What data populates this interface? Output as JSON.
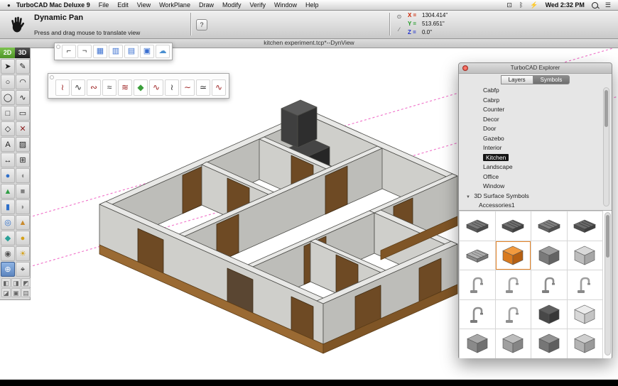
{
  "menu_bar": {
    "apple_glyph": "●",
    "app_name": "TurboCAD Mac Deluxe 9",
    "menus": [
      "File",
      "Edit",
      "View",
      "WorkPlane",
      "Draw",
      "Modify",
      "Verify",
      "Window",
      "Help"
    ],
    "status_icons": [
      {
        "name": "display-icon",
        "glyph": "⊡"
      },
      {
        "name": "bluetooth-icon",
        "glyph": "ᛒ"
      },
      {
        "name": "battery-icon",
        "glyph": "⚡"
      }
    ],
    "clock": "Wed 2:32 PM",
    "notification_icon": "☰"
  },
  "toolbar": {
    "tool_title": "Dynamic Pan",
    "tool_hint": "Press and drag mouse to translate view",
    "help_label": "?",
    "mini_icon_top": "⊙",
    "mini_icon_bottom": "∕",
    "coords": {
      "x_label": "X =",
      "x_value": "1304.414\"",
      "x_color": "#cc2200",
      "y_label": "Y =",
      "y_value": "513.651\"",
      "y_color": "#1f9922",
      "z_label": "Z =",
      "z_value": "0.0\"",
      "z_color": "#2233cc"
    }
  },
  "doc_bar": {
    "title": "kitchen experiment.tcp*--DynView"
  },
  "canvas": {
    "construction_line_color": "#f06fc8"
  },
  "palette": {
    "mode_2d_label": "2D",
    "mode_3d_label": "3D",
    "tools": [
      {
        "name": "select-tool-icon",
        "glyph": "➤",
        "color": "#1c1c1c"
      },
      {
        "name": "pen-tool-icon",
        "glyph": "✎",
        "color": "#1c1c1c"
      },
      {
        "name": "circle-tool-icon",
        "glyph": "○",
        "color": "#1c1c1c"
      },
      {
        "name": "arc-tool-icon",
        "glyph": "◠",
        "color": "#1c1c1c"
      },
      {
        "name": "ellipse-tool-icon",
        "glyph": "◯",
        "color": "#1c1c1c"
      },
      {
        "name": "spline-tool-icon",
        "glyph": "∿",
        "color": "#1c1c1c"
      },
      {
        "name": "rectangle-tool-icon",
        "glyph": "□",
        "color": "#1c1c1c"
      },
      {
        "name": "rounded-rectangle-tool-icon",
        "glyph": "▭",
        "color": "#1c1c1c"
      },
      {
        "name": "polygon-tool-icon",
        "glyph": "◇",
        "color": "#1c1c1c"
      },
      {
        "name": "cross-line-tool-icon",
        "glyph": "✕",
        "color": "#8a1a1a"
      },
      {
        "name": "text-tool-icon",
        "glyph": "A",
        "color": "#1c1c1c"
      },
      {
        "name": "hatch-tool-icon",
        "glyph": "▨",
        "color": "#1c1c1c"
      },
      {
        "name": "dimension-tool-icon",
        "glyph": "↔",
        "color": "#1c1c1c"
      },
      {
        "name": "grid-tool-icon",
        "glyph": "⊞",
        "color": "#1c1c1c"
      },
      {
        "name": "sphere-tool-icon",
        "glyph": "●",
        "color": "#2e6fca"
      },
      {
        "name": "hemisphere-tool-icon",
        "glyph": "◖",
        "color": "#8a8a8a"
      },
      {
        "name": "cone-tool-icon",
        "glyph": "▲",
        "color": "#2f9e44"
      },
      {
        "name": "box-tool-icon",
        "glyph": "■",
        "color": "#808080"
      },
      {
        "name": "cylinder-tool-icon",
        "glyph": "▮",
        "color": "#2e6fca"
      },
      {
        "name": "dome-tool-icon",
        "glyph": "◗",
        "color": "#8a8a8a"
      },
      {
        "name": "torus-tool-icon",
        "glyph": "◎",
        "color": "#2e6fca"
      },
      {
        "name": "pyramid-tool-icon",
        "glyph": "▲",
        "color": "#c98a2e"
      },
      {
        "name": "prism-tool-icon",
        "glyph": "◆",
        "color": "#2aa198"
      },
      {
        "name": "extrude-tool-icon",
        "glyph": "●",
        "color": "#d4a017"
      },
      {
        "name": "camera-tool-icon",
        "glyph": "◉",
        "color": "#555555"
      },
      {
        "name": "light-tool-icon",
        "glyph": "☀",
        "color": "#d4a017"
      },
      {
        "name": "pan-tool-icon",
        "glyph": "⊕",
        "color": "#1a3f8f",
        "sel": true
      },
      {
        "name": "zoom-tool-icon",
        "glyph": "⌖",
        "color": "#1c1c1c"
      }
    ],
    "view_cubes": [
      {
        "name": "view-cube-top-icon",
        "glyph": "◧"
      },
      {
        "name": "view-cube-front-icon",
        "glyph": "◨"
      },
      {
        "name": "view-cube-side-icon",
        "glyph": "◩"
      },
      {
        "name": "view-cube-iso-icon",
        "glyph": "◪"
      },
      {
        "name": "view-cube-back-icon",
        "glyph": "▣"
      },
      {
        "name": "view-cube-bottom-icon",
        "glyph": "▤"
      }
    ]
  },
  "float_doors": {
    "icons": [
      {
        "name": "door-tool-icon",
        "glyph": "⌐",
        "color": "#333333"
      },
      {
        "name": "double-door-tool-icon",
        "glyph": "¬",
        "color": "#333333"
      },
      {
        "name": "window-grid-tool-icon",
        "glyph": "▦",
        "color": "#3a6fd0"
      },
      {
        "name": "window-pane-tool-icon",
        "glyph": "▥",
        "color": "#3a6fd0"
      },
      {
        "name": "sliding-window-tool-icon",
        "glyph": "▤",
        "color": "#3a6fd0"
      },
      {
        "name": "wall-opening-tool-icon",
        "glyph": "▣",
        "color": "#3a6fd0"
      },
      {
        "name": "roof-tool-icon",
        "glyph": "☁",
        "color": "#4a8fd0"
      }
    ]
  },
  "float_curves": {
    "icons": [
      {
        "name": "spline-wall-icon",
        "glyph": "≀",
        "color": "#a02828"
      },
      {
        "name": "wavy-wall-icon",
        "glyph": "∿",
        "color": "#333333"
      },
      {
        "name": "arc-wall-icon",
        "glyph": "∾",
        "color": "#a02828"
      },
      {
        "name": "bezier-wall-icon",
        "glyph": "≈",
        "color": "#333333"
      },
      {
        "name": "cloud-wall-icon",
        "glyph": "≋",
        "color": "#a02828"
      },
      {
        "name": "symbol-diamond-icon",
        "glyph": "◆",
        "color": "#3a9e3a"
      },
      {
        "name": "zigzag-wall-icon",
        "glyph": "∿",
        "color": "#a02828"
      },
      {
        "name": "loop-wall-icon",
        "glyph": "≀",
        "color": "#333333"
      },
      {
        "name": "curve-wall-icon",
        "glyph": "∼",
        "color": "#a02828"
      },
      {
        "name": "smooth-wall-icon",
        "glyph": "≃",
        "color": "#333333"
      },
      {
        "name": "revision-cloud-icon",
        "glyph": "∿",
        "color": "#a02828"
      }
    ]
  },
  "explorer": {
    "title": "TurboCAD Explorer",
    "tabs": [
      {
        "name": "tab-layers",
        "label": "Layers"
      },
      {
        "name": "tab-symbols",
        "label": "Symbols",
        "active": true
      }
    ],
    "categories": [
      {
        "label": "Cabfp"
      },
      {
        "label": "Cabrp"
      },
      {
        "label": "Counter"
      },
      {
        "label": "Decor"
      },
      {
        "label": "Door"
      },
      {
        "label": "Gazebo"
      },
      {
        "label": "Interior"
      },
      {
        "label": "Kitchen",
        "selected": true
      },
      {
        "label": "Landscape"
      },
      {
        "label": "Office"
      },
      {
        "label": "Window"
      }
    ],
    "section_label": "3D Surface Symbols",
    "subitem_label": "Accessories1",
    "thumbnails": [
      {
        "name": "sink-grate-symbol",
        "shape": "flat",
        "c1": "#7a7a7a",
        "c2": "#5c5c5c",
        "c3": "#4a4a4a"
      },
      {
        "name": "double-sink-symbol",
        "shape": "flat",
        "c1": "#707070",
        "c2": "#525252",
        "c3": "#404040"
      },
      {
        "name": "single-sink-symbol",
        "shape": "flat",
        "c1": "#828282",
        "c2": "#646464",
        "c3": "#505050"
      },
      {
        "name": "drain-grate-symbol",
        "shape": "flat",
        "c1": "#6a6a6a",
        "c2": "#4e4e4e",
        "c3": "#3e3e3e"
      },
      {
        "name": "drainboard-sink-symbol",
        "shape": "flat",
        "c1": "#b0b0b0",
        "c2": "#8e8e8e",
        "c3": "#777777"
      },
      {
        "name": "base-cabinet-symbol",
        "shape": "cube",
        "c1": "#f29a3e",
        "c2": "#d97a1e",
        "c3": "#b55f12",
        "sel": true
      },
      {
        "name": "wall-cabinet-symbol",
        "shape": "cube",
        "c1": "#9a9a9a",
        "c2": "#7a7a7a",
        "c3": "#636363"
      },
      {
        "name": "refrigerator-symbol",
        "shape": "cube",
        "c1": "#d9d9d9",
        "c2": "#bdbdbd",
        "c3": "#a6a6a6"
      },
      {
        "name": "faucet-gooseneck-symbol",
        "shape": "faucet",
        "c1": "#cccccc",
        "c2": "#9a9a9a",
        "c3": "#8a8a8a"
      },
      {
        "name": "faucet-single-symbol",
        "shape": "faucet",
        "c1": "#cccccc",
        "c2": "#a8a8a8",
        "c3": "#909090"
      },
      {
        "name": "faucet-lever-symbol",
        "shape": "faucet",
        "c1": "#cccccc",
        "c2": "#8f8f8f",
        "c3": "#7f7f7f"
      },
      {
        "name": "faucet-double-symbol",
        "shape": "faucet",
        "c1": "#cccccc",
        "c2": "#9f9f9f",
        "c3": "#8a8a8a"
      },
      {
        "name": "faucet-spray-symbol",
        "shape": "faucet",
        "c1": "#cccccc",
        "c2": "#8f8f8f",
        "c3": "#7a7a7a"
      },
      {
        "name": "sprayer-head-symbol",
        "shape": "faucet",
        "c1": "#cccccc",
        "c2": "#a5a5a5",
        "c3": "#8f8f8f"
      },
      {
        "name": "tall-cabinet-symbol",
        "shape": "cube",
        "c1": "#5f5f5f",
        "c2": "#484848",
        "c3": "#383838"
      },
      {
        "name": "small-appliance-symbol",
        "shape": "cube",
        "c1": "#ececec",
        "c2": "#d8d8d8",
        "c3": "#c4c4c4"
      },
      {
        "name": "counter-unit-symbol",
        "shape": "cube",
        "c1": "#a8a8a8",
        "c2": "#8a8a8a",
        "c3": "#707070"
      },
      {
        "name": "corner-cabinet-symbol",
        "shape": "cube",
        "c1": "#bdbdbd",
        "c2": "#9f9f9f",
        "c3": "#858585"
      },
      {
        "name": "island-cabinet-symbol",
        "shape": "cube",
        "c1": "#939393",
        "c2": "#767676",
        "c3": "#5f5f5f"
      },
      {
        "name": "sink-base-symbol",
        "shape": "cube",
        "c1": "#cfcfcf",
        "c2": "#b3b3b3",
        "c3": "#9a9a9a"
      }
    ]
  }
}
